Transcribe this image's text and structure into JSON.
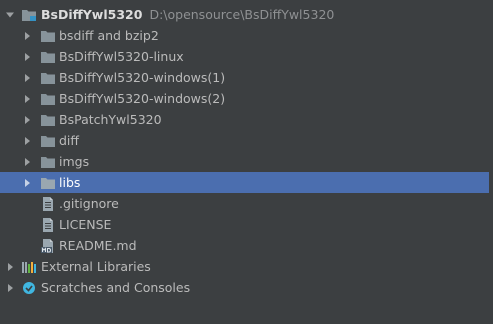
{
  "project_tree": {
    "root": {
      "name": "BsDiffYwl5320",
      "path": "D:\\opensource\\BsDiffYwl5320",
      "icon": "module-folder-icon",
      "expanded": true
    },
    "items": [
      {
        "label": "bsdiff and bzip2",
        "icon": "folder-icon",
        "expandable": true
      },
      {
        "label": "BsDiffYwl5320-linux",
        "icon": "folder-icon",
        "expandable": true
      },
      {
        "label": "BsDiffYwl5320-windows(1)",
        "icon": "folder-icon",
        "expandable": true
      },
      {
        "label": "BsDiffYwl5320-windows(2)",
        "icon": "folder-icon",
        "expandable": true
      },
      {
        "label": "BsPatchYwl5320",
        "icon": "folder-icon",
        "expandable": true
      },
      {
        "label": "diff",
        "icon": "folder-icon",
        "expandable": true
      },
      {
        "label": "imgs",
        "icon": "folder-icon",
        "expandable": true
      },
      {
        "label": "libs",
        "icon": "folder-icon",
        "expandable": true,
        "selected": true
      },
      {
        "label": ".gitignore",
        "icon": "text-file-icon",
        "expandable": false
      },
      {
        "label": "LICENSE",
        "icon": "text-file-icon",
        "expandable": false
      },
      {
        "label": "README.md",
        "icon": "markdown-file-icon",
        "expandable": false
      }
    ],
    "external_libraries": {
      "label": "External Libraries",
      "icon": "libraries-icon"
    },
    "scratches": {
      "label": "Scratches and Consoles",
      "icon": "scratches-icon"
    }
  },
  "colors": {
    "background": "#3c3f41",
    "selection": "#4b6eaf",
    "text": "#bbbbbb",
    "folder": "#87939a"
  }
}
